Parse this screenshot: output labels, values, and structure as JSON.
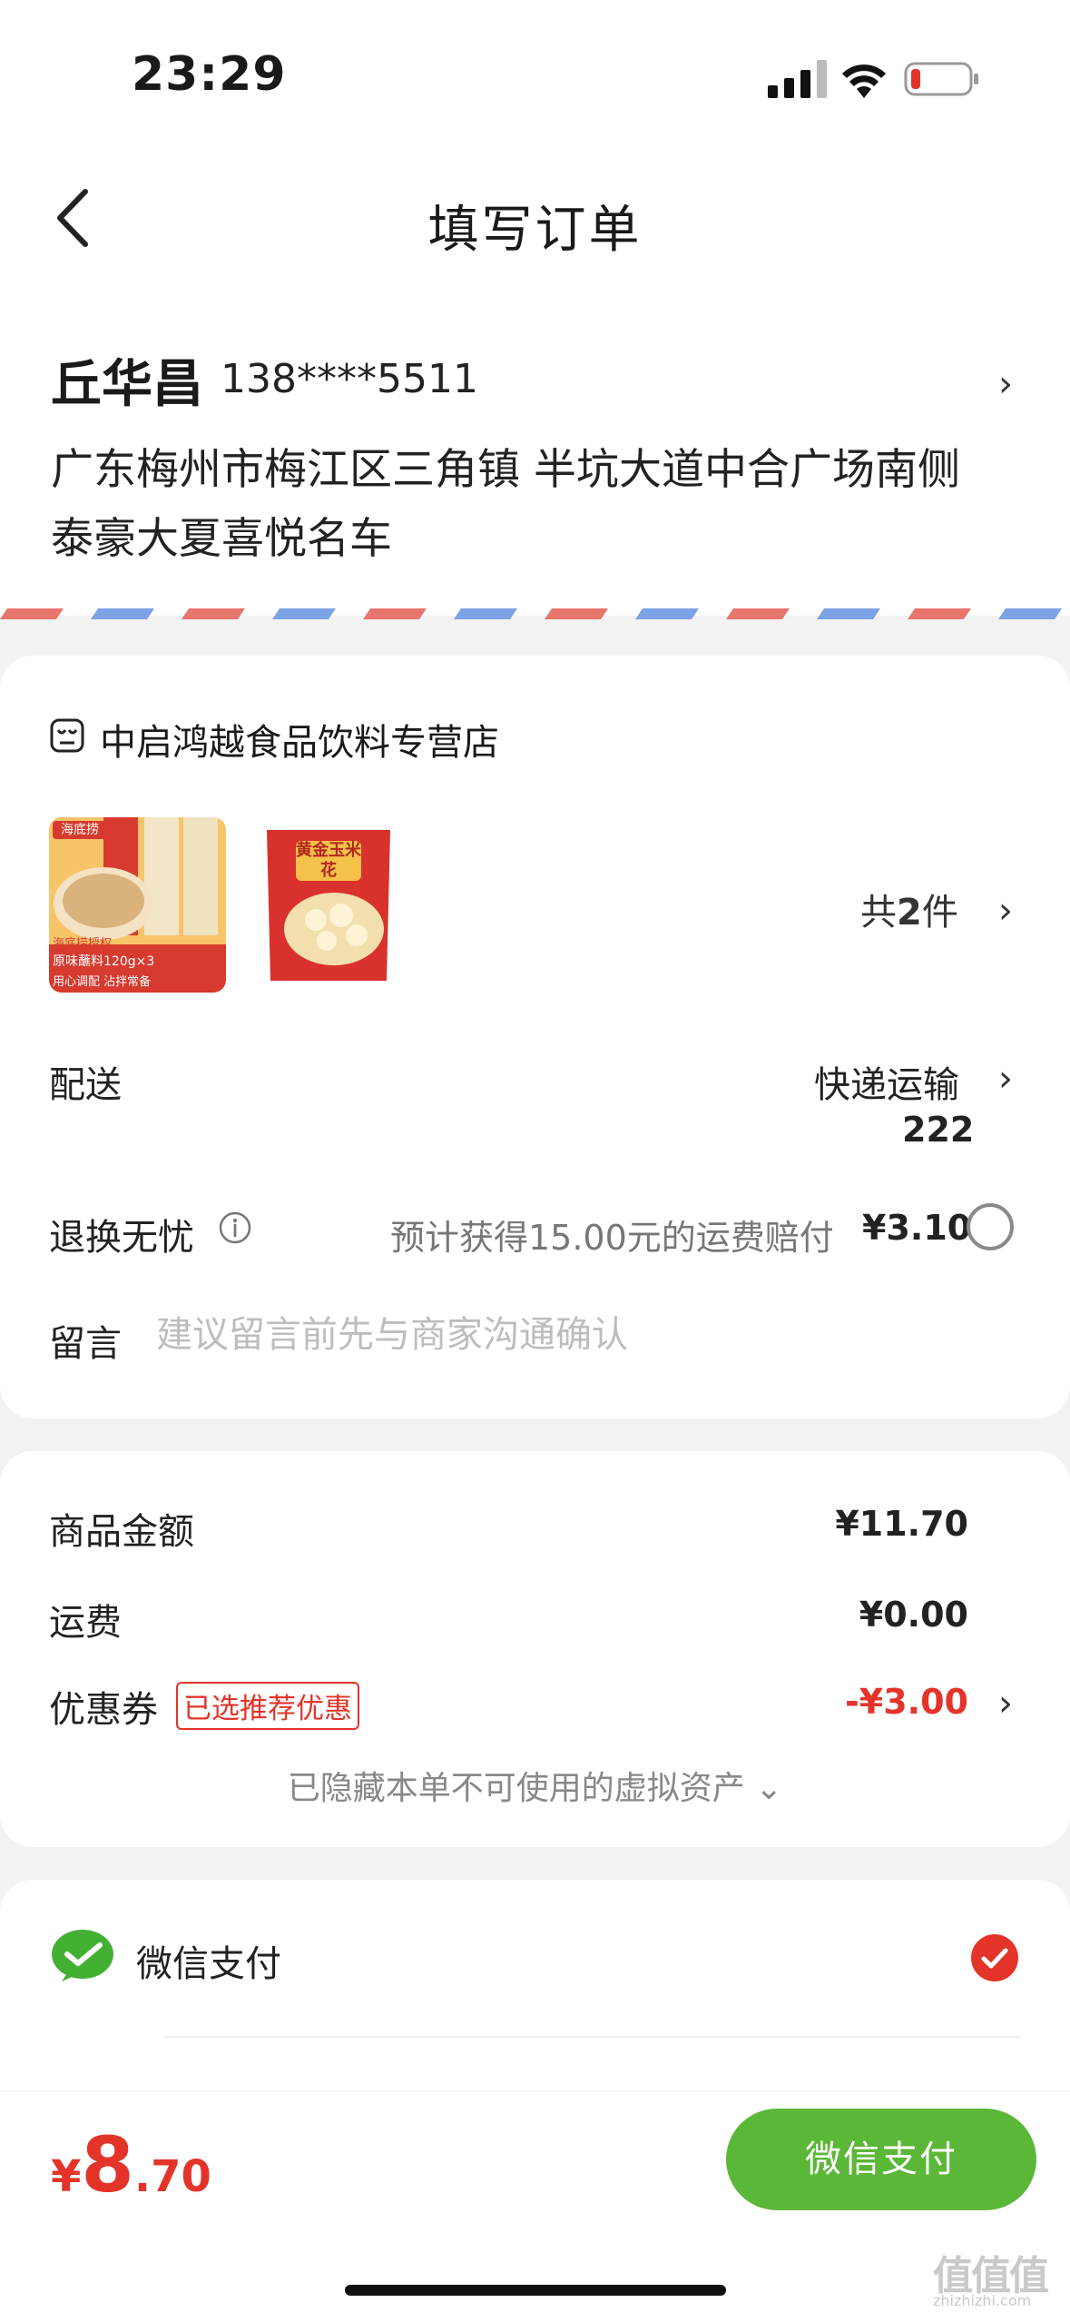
{
  "status_bar": {
    "time": "23:29"
  },
  "header": {
    "title": "填写订单"
  },
  "address": {
    "name": "丘华昌",
    "phone": "138****5511",
    "detail": "广东梅州市梅江区三角镇 半坑大道中合广场南侧泰豪大夏喜悦名车"
  },
  "store": {
    "name": "中启鸿越食品饮料专营店",
    "product1": {
      "brand": "海底捞",
      "line1": "海底捞授权",
      "line2": "原味蘸料120g×3",
      "line3": "用心调配 沾拌常备"
    },
    "product2": {
      "title": "黄金玉米花"
    },
    "count_prefix": "共",
    "count": "2",
    "count_suffix": "件"
  },
  "delivery": {
    "label": "配送",
    "method": "快递运输",
    "sub": "222"
  },
  "returns": {
    "label": "退换无忧",
    "desc": "预计获得15.00元的运费赔付",
    "price": "¥3.10"
  },
  "message": {
    "label": "留言",
    "placeholder": "建议留言前先与商家沟通确认"
  },
  "summary": {
    "goods_label": "商品金额",
    "goods_value": "¥11.70",
    "shipping_label": "运费",
    "shipping_value": "¥0.00",
    "coupon_label": "优惠券",
    "coupon_tag": "已选推荐优惠",
    "coupon_value": "-¥3.00",
    "hidden_note": "已隐藏本单不可使用的虚拟资产 ⌄"
  },
  "payment": {
    "method_label": "微信支付"
  },
  "footer": {
    "currency": "¥",
    "total_int": "8",
    "total_dec": ".70",
    "pay_button": "微信支付"
  },
  "watermark": {
    "main": "值值值",
    "sub": "zhizhizhi.com"
  },
  "colors": {
    "accent_red": "#e4342a",
    "wechat_green": "#5bb738",
    "background": "#f2f2f2"
  }
}
